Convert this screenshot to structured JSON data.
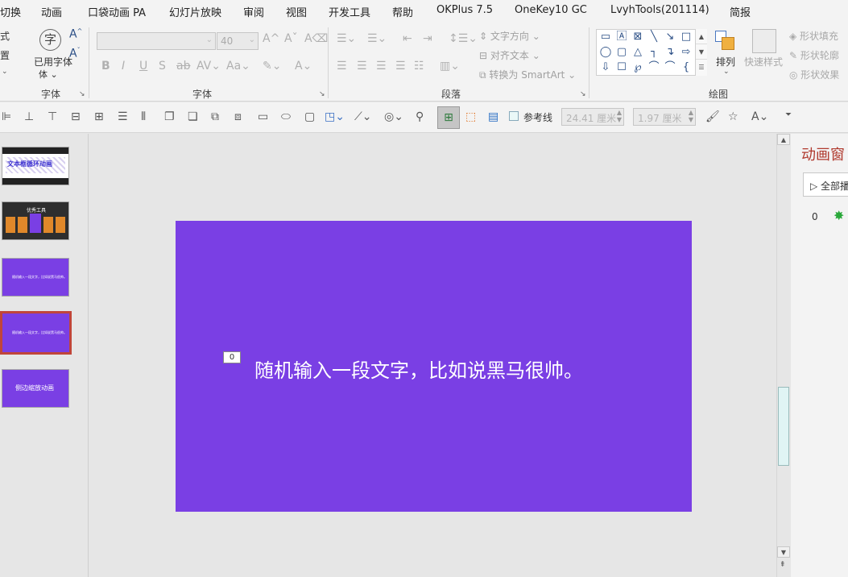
{
  "menu": {
    "items": [
      "切换",
      "动画",
      "口袋动画 PA",
      "幻灯片放映",
      "审阅",
      "视图",
      "开发工具",
      "帮助",
      "OKPlus 7.5",
      "OneKey10 GC",
      "LvyhTools(201114)",
      "简报"
    ]
  },
  "ribbon": {
    "left_partial": [
      "式",
      "置"
    ],
    "font_group1": {
      "label": "字体",
      "button_label": "已用字体",
      "icon_glyph": "字"
    },
    "font_group": {
      "label": "字体",
      "font_name": "",
      "font_size": "40"
    },
    "paragraph_group": {
      "label": "段落",
      "text_direction": "文字方向",
      "align_text": "对齐文本",
      "convert_smartart": "转换为 SmartArt"
    },
    "drawing_group": {
      "label": "绘图",
      "arrange": "排列",
      "quick_styles": "快速样式",
      "shape_fill": "形状填充",
      "shape_outline": "形状轮廓",
      "shape_effects": "形状效果"
    }
  },
  "toolbar2": {
    "guides_label": "参考线",
    "width_value": "24.41 厘米",
    "height_value": "1.97 厘米"
  },
  "slides": {
    "thumbnails": [
      {
        "text": "文本框循环动画",
        "selected": false
      },
      {
        "text": "优秀工具",
        "selected": false
      },
      {
        "text": "随机输入一段文字，比如说黑马很帅。",
        "selected": false
      },
      {
        "text": "随机输入一段文字，比如说黑马很帅。",
        "selected": true
      },
      {
        "text": "侧边缩放动画",
        "selected": false
      }
    ]
  },
  "slide": {
    "text": "随机输入一段文字，比如说黑马很帅。",
    "animation_tag": "0",
    "background_color": "#7a3fe4"
  },
  "animation_pane": {
    "title": "动画窗",
    "play_all": "全部播",
    "item_number": "0"
  },
  "colors": {
    "accent_red": "#c0453a",
    "slide_purple": "#7a3fe4"
  }
}
